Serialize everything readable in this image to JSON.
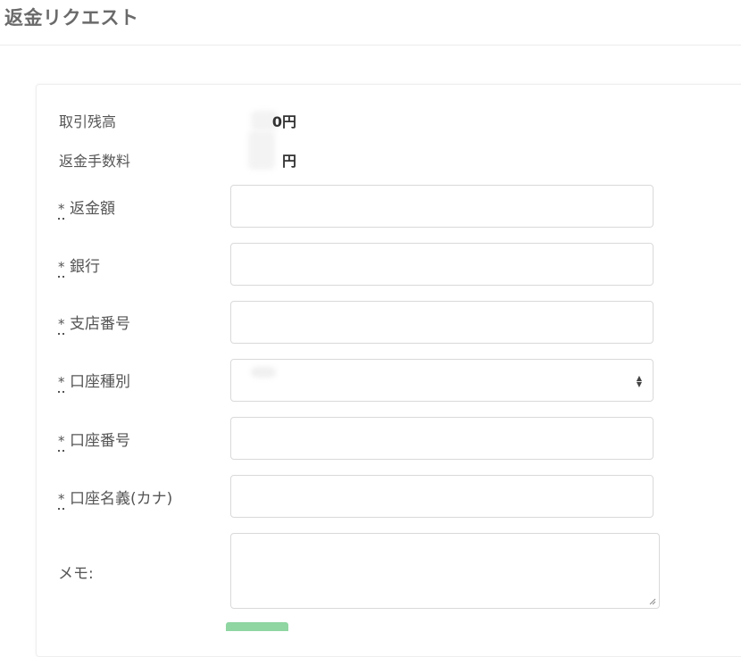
{
  "header": {
    "title": "返金リクエスト"
  },
  "summary": {
    "balance_label": "取引残高",
    "balance_value": "0円",
    "fee_label": "返金手数料",
    "fee_value": "円"
  },
  "form": {
    "required_mark": "*",
    "fields": {
      "amount": {
        "label": "返金額",
        "value": ""
      },
      "bank": {
        "label": "銀行",
        "value": ""
      },
      "branch": {
        "label": "支店番号",
        "value": ""
      },
      "account_type": {
        "label": "口座種別",
        "selected": ""
      },
      "account_number": {
        "label": "口座番号",
        "value": ""
      },
      "account_name": {
        "label": "口座名義(カナ)",
        "value": ""
      }
    },
    "memo": {
      "label": "メモ:",
      "value": ""
    }
  },
  "icons": {
    "select": "select-updown-icon",
    "resize": "resize-grip-icon"
  },
  "colors": {
    "submit_button": "#8fd6a2"
  }
}
